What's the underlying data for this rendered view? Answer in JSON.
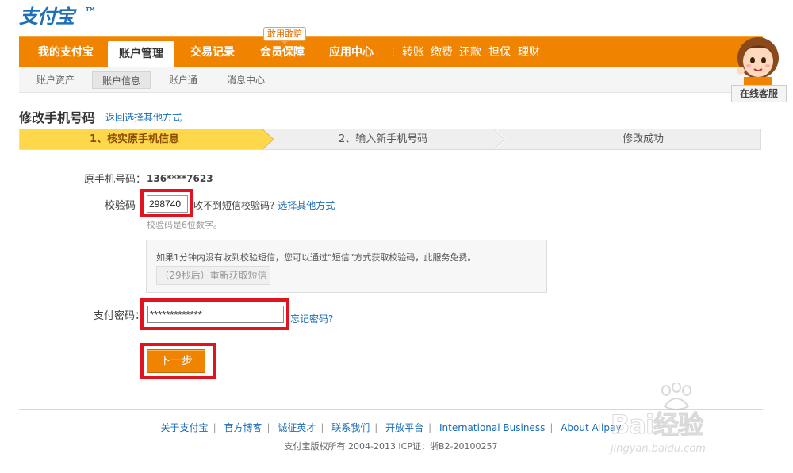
{
  "logo": {
    "text": "支付宝",
    "tm": "TM"
  },
  "nav": {
    "items": [
      {
        "label": "我的支付宝"
      },
      {
        "label": "账户管理"
      },
      {
        "label": "交易记录"
      },
      {
        "label": "会员保障"
      },
      {
        "label": "应用中心"
      }
    ],
    "promo": "敢用敢赔",
    "quick_links": [
      "转账",
      "缴费",
      "还款",
      "担保",
      "理财"
    ]
  },
  "subnav": {
    "items": [
      "账户资产",
      "账户信息",
      "账户通",
      "消息中心"
    ]
  },
  "customer_service": {
    "label": "在线客服"
  },
  "page": {
    "title": "修改手机号码",
    "back_link": "返回选择其他方式"
  },
  "steps": [
    "1、核实原手机信息",
    "2、输入新手机号码",
    "修改成功"
  ],
  "form": {
    "phone_label": "原手机号码：",
    "phone_value": "136****7623",
    "code_label": "校验码",
    "code_value": "298740",
    "no_code_text": "收不到短信校验码?",
    "other_method_link": "选择其他方式",
    "code_hint": "校验码是6位数字。",
    "info_text": "如果1分钟内没有收到校验短信，您可以通过“短信”方式获取校验码，此服务免费。",
    "resend_label": "（29秒后）重新获取短信",
    "pwd_label": "支付密码：",
    "pwd_value": "*************",
    "forgot_link": "忘记密码?",
    "next_label": "下一步"
  },
  "footer": {
    "links": [
      "关于支付宝",
      "官方博客",
      "诚征英才",
      "联系我们",
      "开放平台",
      "International Business",
      "About Alipay"
    ],
    "copyright": "支付宝版权所有 2004-2013 ICP证：浙B2-20100257"
  },
  "watermark": {
    "brand": "Bai经验",
    "url": "jingyan.baidu.com"
  },
  "colors": {
    "nav_orange": "#f08300",
    "highlight_red": "#e0141e",
    "link_blue": "#1a6bb5",
    "step_active": "#ffd74a"
  }
}
